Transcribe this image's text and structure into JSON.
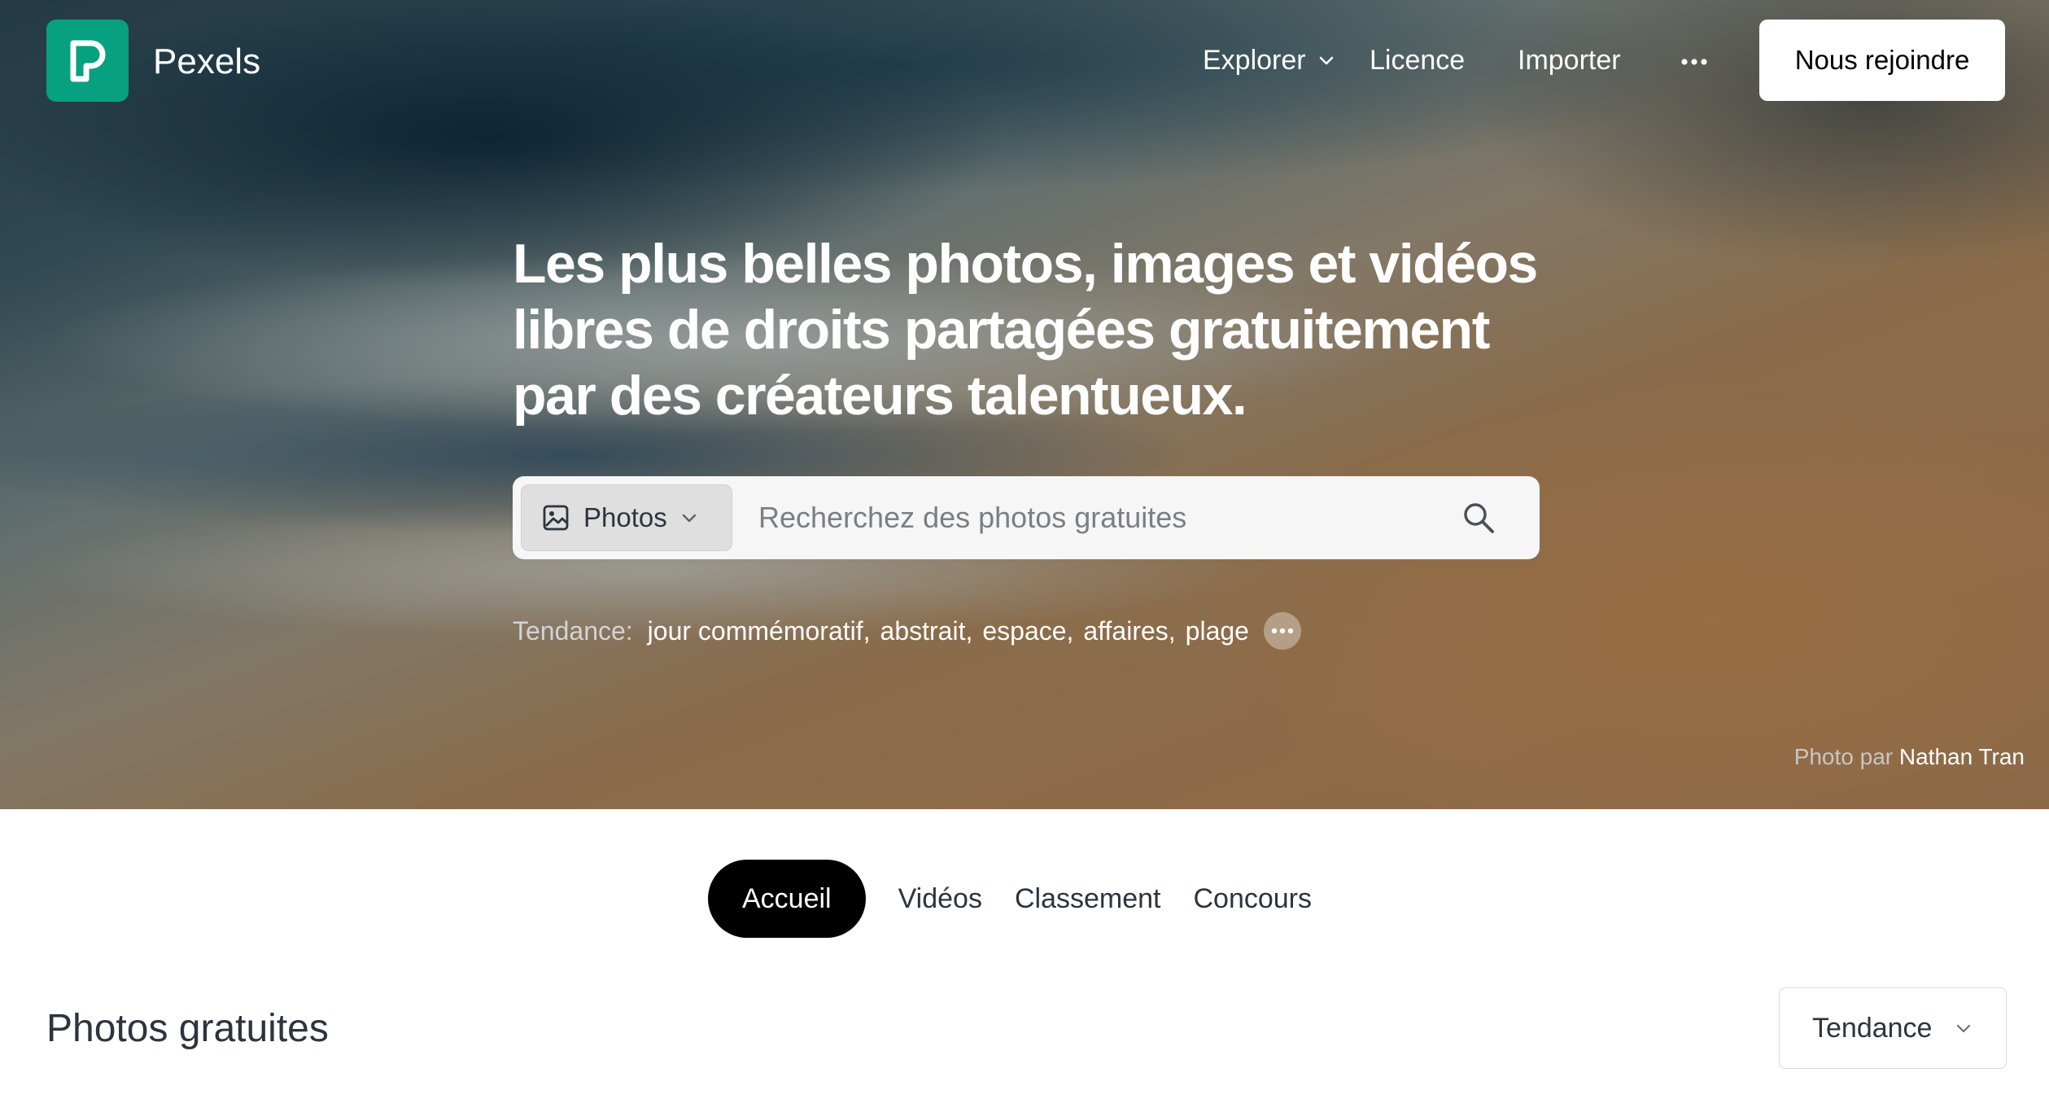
{
  "brand": {
    "name": "Pexels",
    "color": "#07a081"
  },
  "nav": {
    "explore_label": "Explorer",
    "license_label": "Licence",
    "upload_label": "Importer",
    "more_icon": "ellipsis-icon",
    "join_label": "Nous rejoindre"
  },
  "hero": {
    "headline": "Les plus belles photos, images et vidéos libres de droits partagées gratuitement par des créateurs talentueux.",
    "search": {
      "type_label": "Photos",
      "placeholder": "Recherchez des photos gratuites"
    },
    "trending": {
      "label": "Tendance:",
      "items": [
        "jour commémoratif",
        "abstrait",
        "espace",
        "affaires",
        "plage"
      ]
    },
    "credit": {
      "prefix": "Photo par",
      "author": "Nathan Tran"
    }
  },
  "tabs": [
    {
      "label": "Accueil",
      "active": true
    },
    {
      "label": "Vidéos",
      "active": false
    },
    {
      "label": "Classement",
      "active": false
    },
    {
      "label": "Concours",
      "active": false
    }
  ],
  "section": {
    "title": "Photos gratuites",
    "sort_label": "Tendance"
  }
}
